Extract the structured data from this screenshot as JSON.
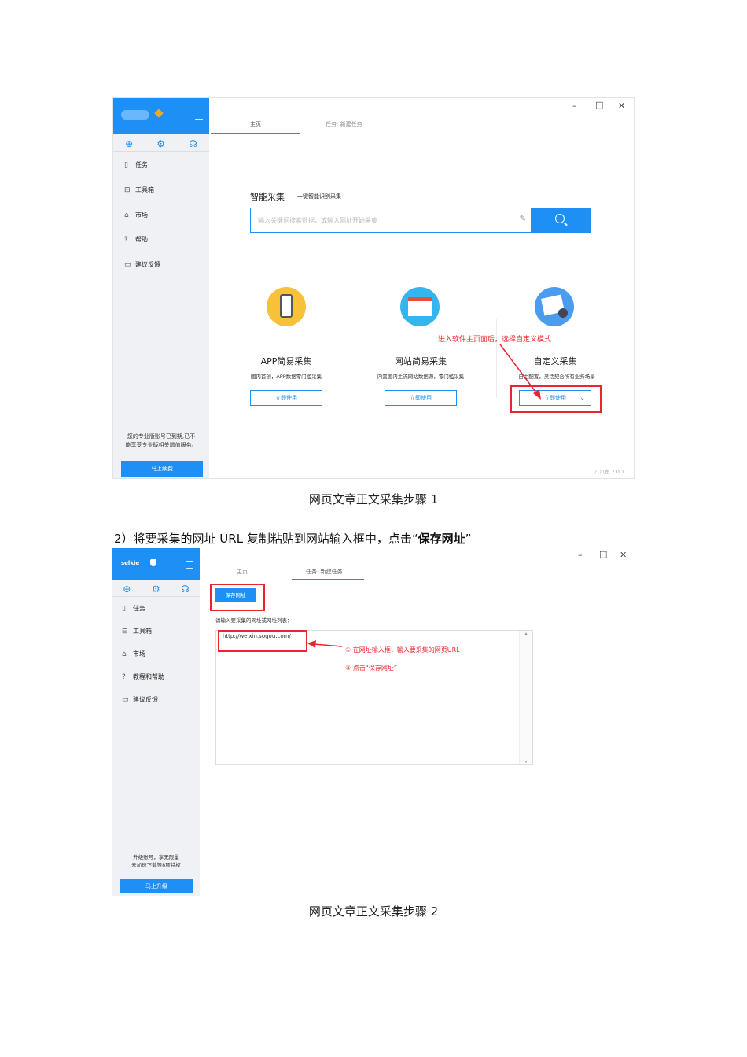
{
  "screen1": {
    "sidebar": {
      "nav": [
        {
          "icon": "document-icon",
          "label": "任务"
        },
        {
          "icon": "toolbox-icon",
          "label": "工具箱"
        },
        {
          "icon": "market-icon",
          "label": "市场"
        },
        {
          "icon": "help-icon",
          "label": "帮助"
        },
        {
          "icon": "feedback-icon",
          "label": "建议反馈"
        }
      ],
      "notice_line1": "您的专业版账号已到期,已不",
      "notice_line2": "能享受专业版相关增值服务。",
      "renew_label": "马上续费"
    },
    "window_controls": {
      "minimize": "–",
      "maximize": "□",
      "close": "✕"
    },
    "tabs": {
      "home": "主页",
      "task": "任务: 新建任务"
    },
    "smart": {
      "title": "智能采集",
      "subtitle": "一键智能识别采集",
      "placeholder": "输入关键词搜索数据，或输入网址开始采集"
    },
    "cards": [
      {
        "title": "APP简易采集",
        "desc": "国内首创，APP数据零门槛采集",
        "button": "立即使用"
      },
      {
        "title": "网站简易采集",
        "desc": "内置国内主流网站数据源，零门槛采集",
        "button": "立即使用"
      },
      {
        "title": "自定义采集",
        "desc": "自由配置，灵活契合所有业务场景",
        "button": "立即使用"
      }
    ],
    "annotation": "进入软件主页面后，选择自定义模式",
    "version": "八爪鱼 7.0.1"
  },
  "caption1": "网页文章正文采集步骤 1",
  "step2_text": "2）将要采集的网址 URL 复制粘贴到网站输入框中，点击“",
  "step2_bold": "保存网址",
  "step2_end": "”",
  "screen2": {
    "sidebar": {
      "username": "selkie",
      "nav": [
        {
          "icon": "document-icon",
          "label": "任务"
        },
        {
          "icon": "toolbox-icon",
          "label": "工具箱"
        },
        {
          "icon": "market-icon",
          "label": "市场"
        },
        {
          "icon": "help-icon",
          "label": "教程和帮助"
        },
        {
          "icon": "feedback-icon",
          "label": "建议反馈"
        }
      ],
      "notice_line1": "升级账号，享无限量",
      "notice_line2": "云加速下载等8项特权",
      "upgrade_label": "马上升级"
    },
    "window_controls": {
      "minimize": "–",
      "maximize": "□",
      "close": "✕"
    },
    "tabs": {
      "home": "主页",
      "task": "任务: 新建任务"
    },
    "save_button": "保存网址",
    "list_label": "请输入要采集的网址或网址列表：",
    "url_value": "http://weixin.sogou.com/",
    "annotation1": "① 在网址输入框，输入要采集的网页URL",
    "annotation2": "② 点击“保存网址”"
  },
  "caption2": "网页文章正文采集步骤 2"
}
